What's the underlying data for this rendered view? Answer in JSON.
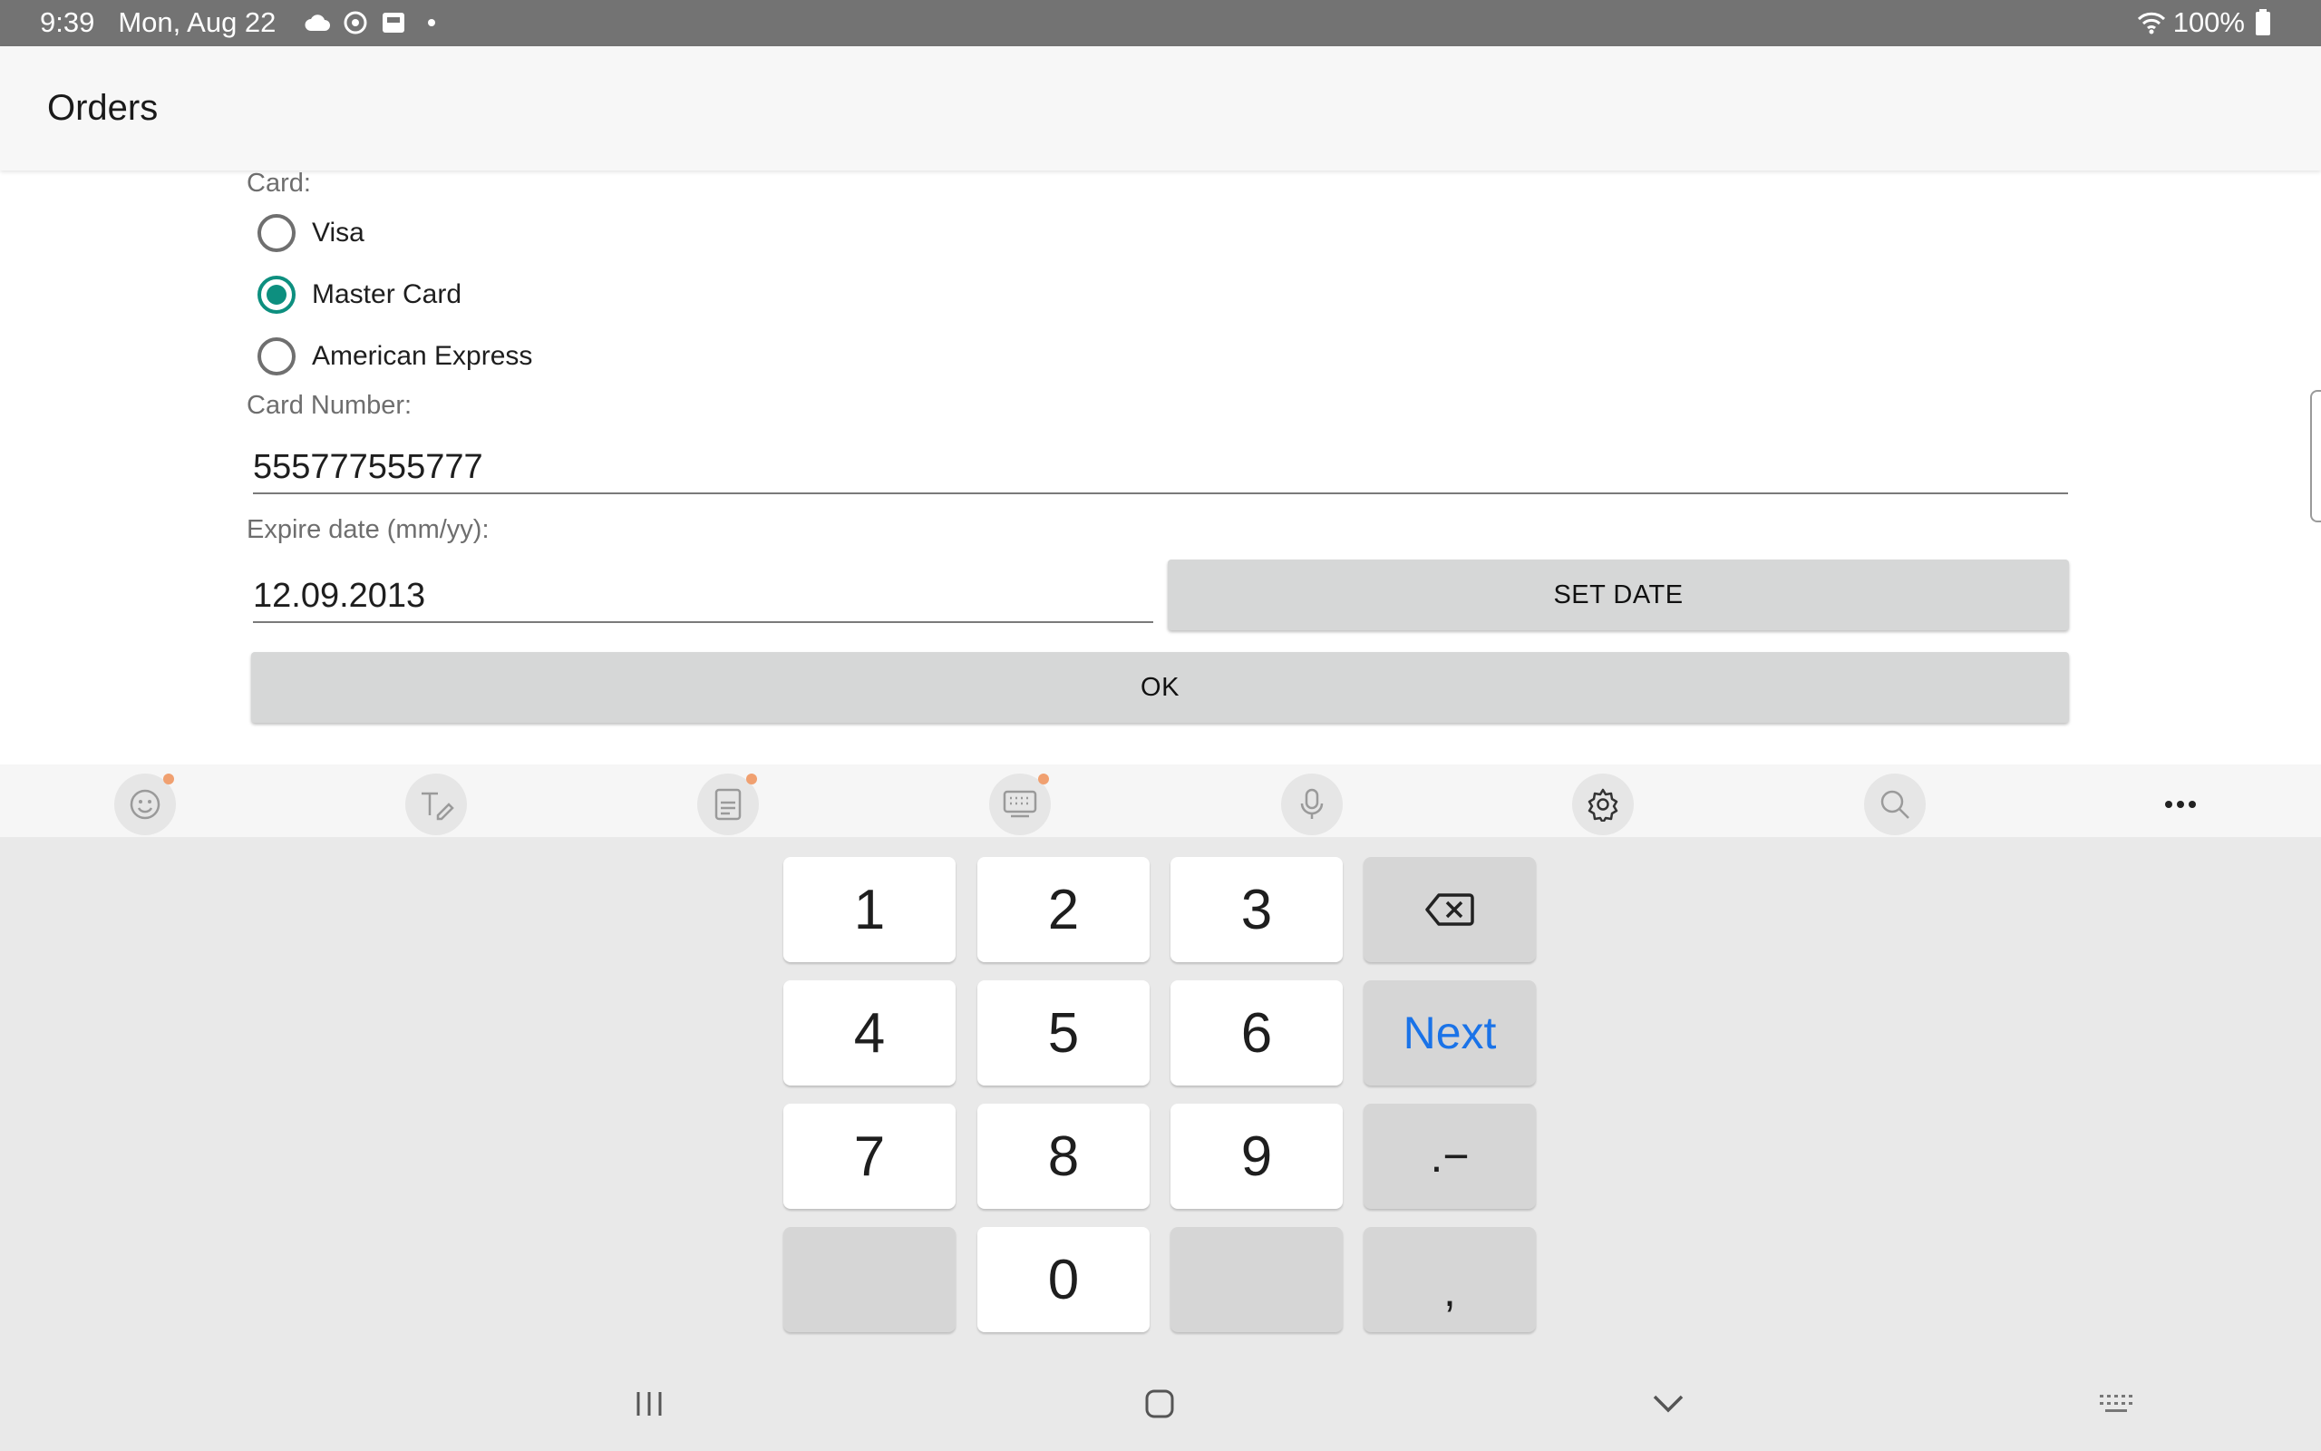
{
  "status_bar": {
    "time": "9:39",
    "date": "Mon, Aug 22",
    "icons": [
      "cloud-icon",
      "sync-icon",
      "notification-icon",
      "dot-icon"
    ],
    "battery": "100%",
    "right_icons": [
      "wifi-icon",
      "battery-icon"
    ]
  },
  "action_bar": {
    "title": "Orders"
  },
  "form": {
    "card_label": "Card:",
    "card_options": [
      {
        "label": "Visa",
        "selected": false
      },
      {
        "label": "Master Card",
        "selected": true
      },
      {
        "label": "American Express",
        "selected": false
      }
    ],
    "card_number_label": "Card Number:",
    "card_number_value": "555777555777",
    "expire_label": "Expire date (mm/yy):",
    "expire_value": "12.09.2013",
    "set_date_button": "SET DATE",
    "ok_button": "OK"
  },
  "keyboard_toolbar": {
    "items": [
      "emoji-icon",
      "handwriting-icon",
      "clipboard-icon",
      "keyboard-mode-icon",
      "microphone-icon",
      "settings-gear-icon",
      "search-icon",
      "more-options-icon"
    ]
  },
  "keyboard": {
    "keys": {
      "k1": "1",
      "k2": "2",
      "k3": "3",
      "k4": "4",
      "k5": "5",
      "k6": "6",
      "k7": "7",
      "k8": "8",
      "k9": "9",
      "k0": "0",
      "next": "Next",
      "dot_dash": ".−",
      "comma": ","
    }
  },
  "nav_bar": {
    "items": [
      "recent-apps-icon",
      "home-icon",
      "back-icon",
      "keyboard-switch-icon"
    ]
  },
  "colors": {
    "status_bar": "#737373",
    "accent": "#0d8f7f",
    "next_key": "#1a73e8",
    "button_bg": "#d6d7d7",
    "keyboard_bg": "#e9e9e9"
  }
}
